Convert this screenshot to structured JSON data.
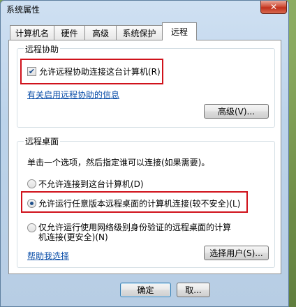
{
  "window": {
    "title": "系统属性",
    "close_glyph": "✕"
  },
  "tabs": [
    {
      "label": "计算机名",
      "active": false
    },
    {
      "label": "硬件",
      "active": false
    },
    {
      "label": "高级",
      "active": false
    },
    {
      "label": "系统保护",
      "active": false
    },
    {
      "label": "远程",
      "active": true
    }
  ],
  "remote_assistance": {
    "group_title": "远程协助",
    "allow_checkbox_label": "允许远程协助连接这台计算机(R)",
    "allow_checked": true,
    "info_link": "有关启用远程协助的信息",
    "advanced_button": "高级(V)..."
  },
  "remote_desktop": {
    "group_title": "远程桌面",
    "instruction": "单击一个选项，然后指定谁可以连接(如果需要)。",
    "options": [
      {
        "label": "不允许连接到这台计算机(D)",
        "selected": false
      },
      {
        "label": "允许运行任意版本远程桌面的计算机连接(较不安全)(L)",
        "selected": true
      },
      {
        "label_line1": "仅允许运行使用网络级别身份验证的远程桌面的计算",
        "label_line2": "机连接(更安全)(N)",
        "selected": false
      }
    ],
    "help_link": "帮助我选择",
    "select_users_button": "选择用户(S)..."
  },
  "footer": {
    "ok_button": "确定",
    "cancel_button": "取..."
  },
  "colors": {
    "highlight_box": "#d0121b",
    "link": "#0b4ea8",
    "title_bar": "#cfe0f2"
  }
}
